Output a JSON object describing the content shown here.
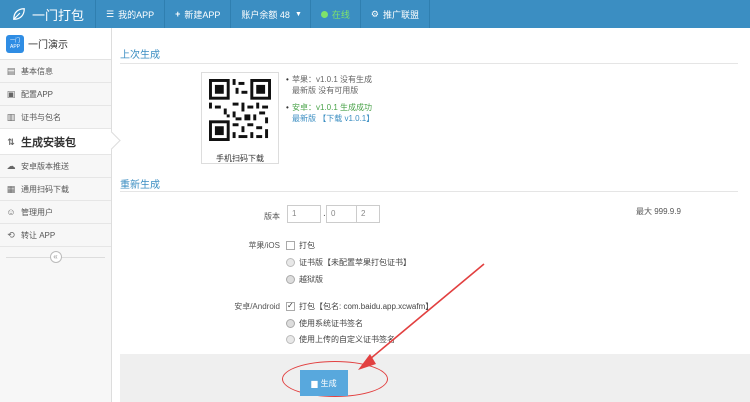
{
  "topbar": {
    "brand": "一门打包",
    "my_app": "我的APP",
    "new_app": "新建APP",
    "balance": "账户余额 48",
    "online": "在线",
    "ads": "推广联盟"
  },
  "sidebar": {
    "app_logo_text": "一门 APP",
    "app_name": "一门演示",
    "items": [
      {
        "label": "基本信息",
        "icon": "info-icon"
      },
      {
        "label": "配置APP",
        "icon": "config-icon"
      },
      {
        "label": "证书与包名",
        "icon": "certificate-icon"
      },
      {
        "label": "生成安装包",
        "icon": "build-icon"
      },
      {
        "label": "安卓版本推送",
        "icon": "cloud-icon"
      },
      {
        "label": "通用扫码下载",
        "icon": "qrcode-icon"
      },
      {
        "label": "管理用户",
        "icon": "user-icon"
      },
      {
        "label": "转让 APP",
        "icon": "transfer-icon"
      }
    ],
    "collapse_label": "«"
  },
  "last_build": {
    "title": "上次生成",
    "qr_caption": "手机扫码下载",
    "ios_line1": "苹果：v1.0.1 没有生成",
    "ios_line2": "最新版 没有可用版",
    "android_line1": "安卓：v1.0.1 生成成功",
    "android_line2_prefix": "最新版 ",
    "android_download": "【下载 v1.0.1】"
  },
  "rebuild": {
    "title": "重新生成",
    "version_label": "版本",
    "version": [
      "1",
      "0",
      "2"
    ],
    "max_note": "最大 999.9.9",
    "ios_label": "苹果/iOS",
    "ios_pack": "打包",
    "ios_cert_option": "证书版【未配置苹果打包证书】",
    "ios_jailbreak_option": "越狱版",
    "android_label": "安卓/Android",
    "android_pack": "打包【包名: com.baidu.app.xcwafm】",
    "android_sys_sign": "使用系统证书签名",
    "android_custom_sign": "使用上传的自定义证书签名",
    "generate_button": "生成"
  },
  "colors": {
    "topbar": "#3b8ec2",
    "accent": "#3b8ec2",
    "success": "#4aa34a",
    "button": "#58a8dd",
    "annotation": "#e24040"
  }
}
